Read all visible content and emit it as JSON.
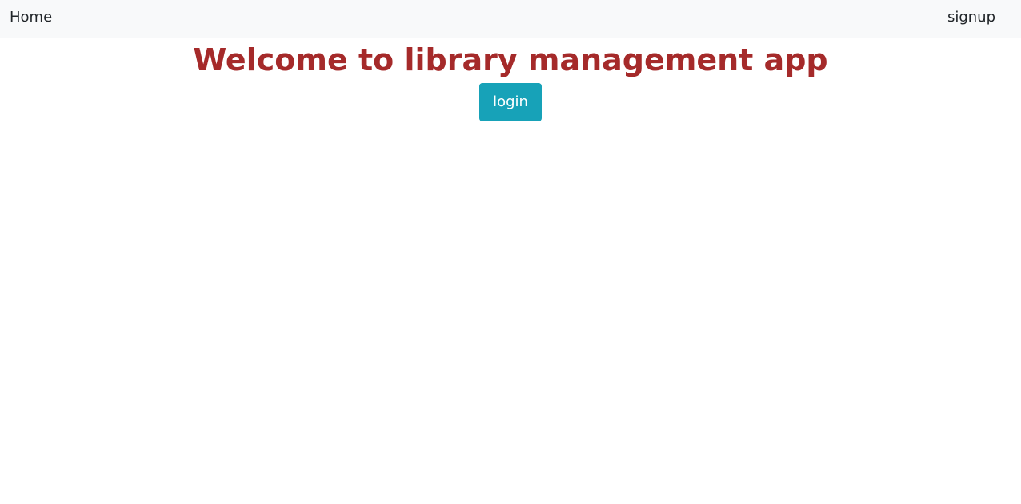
{
  "navbar": {
    "home_label": "Home",
    "signup_label": "signup"
  },
  "main": {
    "title": "Welcome to library management app",
    "login_label": "login"
  },
  "colors": {
    "navbar_bg": "#f8f9fa",
    "title": "#a52a2a",
    "button_bg": "#17a2b8",
    "button_text": "#ffffff"
  }
}
